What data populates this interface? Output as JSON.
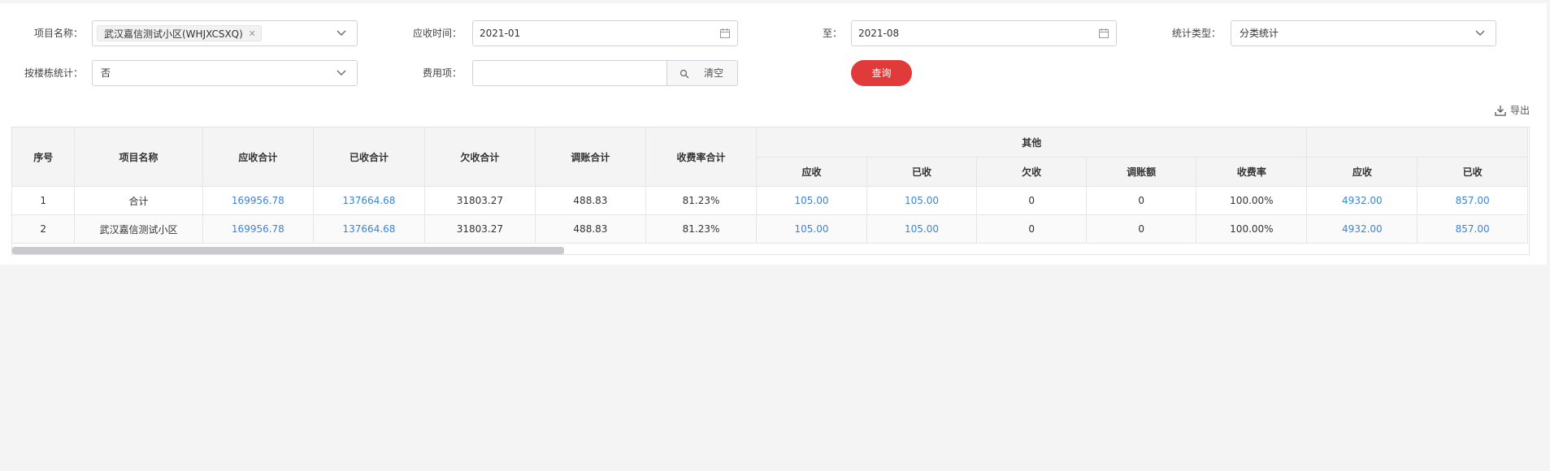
{
  "filters": {
    "project_label": "项目名称：",
    "project_tag": "武汉嘉信测试小区(WHJXCSXQ)",
    "due_time_label": "应收时间：",
    "date_from": "2021-01",
    "to_label": "至：",
    "date_to": "2021-08",
    "stat_type_label": "统计类型：",
    "stat_type_value": "分类统计",
    "by_building_label": "按楼栋统计：",
    "by_building_value": "否",
    "fee_item_label": "费用项：",
    "fee_item_value": "",
    "clear_label": "清空",
    "query_label": "查询"
  },
  "toolbar": {
    "export_label": "导出"
  },
  "table": {
    "headers": {
      "index": "序号",
      "project": "项目名称",
      "due_total": "应收合计",
      "received_total": "已收合计",
      "owed_total": "欠收合计",
      "adjust_total": "调账合计",
      "rate_total": "收费率合计",
      "group_other": "其他",
      "sub": [
        "应收",
        "已收",
        "欠收",
        "调账额",
        "收费率",
        "应收",
        "已收"
      ]
    },
    "rows": [
      {
        "cells": [
          "1",
          "合计",
          "169956.78",
          "137664.68",
          "31803.27",
          "488.83",
          "81.23%",
          "105.00",
          "105.00",
          "0",
          "0",
          "100.00%",
          "4932.00",
          "857.00"
        ]
      },
      {
        "cells": [
          "2",
          "武汉嘉信测试小区",
          "169956.78",
          "137664.68",
          "31803.27",
          "488.83",
          "81.23%",
          "105.00",
          "105.00",
          "0",
          "0",
          "100.00%",
          "4932.00",
          "857.00"
        ]
      }
    ]
  },
  "scroll": {
    "horizontal_fraction": 0.36
  },
  "colors": {
    "accent_red": "#e03a3a",
    "link_blue": "#3a84d8"
  }
}
